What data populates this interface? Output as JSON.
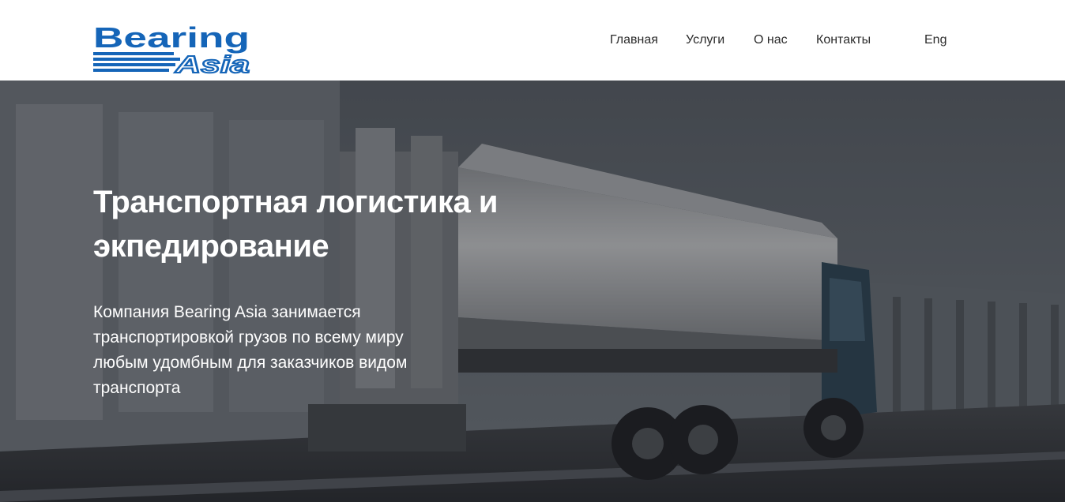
{
  "logo": {
    "brand_top": "Bearing",
    "brand_bottom": "Asia",
    "color_primary": "#1565b8",
    "color_accent": "#0f8fd6"
  },
  "nav": {
    "items": [
      {
        "label": "Главная"
      },
      {
        "label": "Услуги"
      },
      {
        "label": "О нас"
      },
      {
        "label": "Контакты"
      }
    ],
    "language": "Eng"
  },
  "hero": {
    "title": "Транспортная логистика и экпедирование",
    "description": "Компания Bearing Asia занимается транспортировкой грузов по всему миру любым удомбным для заказчиков видом транспорта",
    "image_subject": "silver-tanker-truck-on-highway"
  }
}
